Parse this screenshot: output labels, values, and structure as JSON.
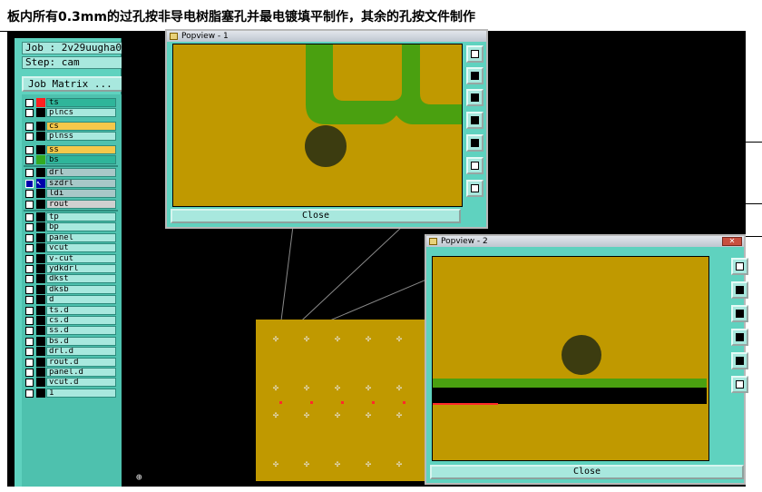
{
  "banner": {
    "text": "板内所有0.3mm的过孔按非导电树脂塞孔并最电镀填平制作，其余的孔按文件制作"
  },
  "job": {
    "job_label": "Job : 2v29uugha0",
    "step_label": "Step: cam",
    "matrix_button": "Job Matrix ..."
  },
  "layers": [
    {
      "name": "ts",
      "color": "#ff2020",
      "bg": "#2fb59a"
    },
    {
      "name": "plncs",
      "color": "#000000",
      "bg": "#a8e8de"
    },
    {
      "name": "cs",
      "color": "#000000",
      "bg": "#f5c84a"
    },
    {
      "name": "plnss",
      "color": "#000000",
      "bg": "#a8e8de"
    },
    {
      "name": "ss",
      "color": "#000000",
      "bg": "#f5c84a"
    },
    {
      "name": "bs",
      "color": "#33aa22",
      "bg": "#2fb59a"
    },
    {
      "name": "drl",
      "color": "#000000",
      "bg": "#a8c8c8"
    },
    {
      "name": "szdrl",
      "color": "#2020ff",
      "bg": "#a8c8c8",
      "active": true
    },
    {
      "name": "ldi",
      "color": "#000000",
      "bg": "#a8c8c8"
    },
    {
      "name": "rout",
      "color": "#000000",
      "bg": "#d0d0d0"
    },
    {
      "name": "tp",
      "color": "#000000",
      "bg": "#a8e8de"
    },
    {
      "name": "bp",
      "color": "#000000",
      "bg": "#a8e8de"
    },
    {
      "name": "panel",
      "color": "#000000",
      "bg": "#a8e8de"
    },
    {
      "name": "vcut",
      "color": "#000000",
      "bg": "#a8e8de"
    },
    {
      "name": "v-cut",
      "color": "#000000",
      "bg": "#a8e8de"
    },
    {
      "name": "ydkdrl",
      "color": "#000000",
      "bg": "#a8e8de"
    },
    {
      "name": "dkst",
      "color": "#000000",
      "bg": "#a8e8de"
    },
    {
      "name": "dksb",
      "color": "#000000",
      "bg": "#a8e8de"
    },
    {
      "name": "d",
      "color": "#000000",
      "bg": "#a8e8de"
    },
    {
      "name": "ts.d",
      "color": "#000000",
      "bg": "#a8e8de"
    },
    {
      "name": "cs.d",
      "color": "#000000",
      "bg": "#a8e8de"
    },
    {
      "name": "ss.d",
      "color": "#000000",
      "bg": "#a8e8de"
    },
    {
      "name": "bs.d",
      "color": "#000000",
      "bg": "#a8e8de"
    },
    {
      "name": "drl.d",
      "color": "#000000",
      "bg": "#a8e8de"
    },
    {
      "name": "rout.d",
      "color": "#000000",
      "bg": "#a8e8de"
    },
    {
      "name": "panel.d",
      "color": "#000000",
      "bg": "#a8e8de"
    },
    {
      "name": "vcut.d",
      "color": "#000000",
      "bg": "#a8e8de"
    },
    {
      "name": "1",
      "color": "#000000",
      "bg": "#a8e8de"
    }
  ],
  "popview1": {
    "title": "Popview - 1",
    "close_label": "Close"
  },
  "popview2": {
    "title": "Popview - 2",
    "close_label": "Close"
  },
  "colors": {
    "board": "#c09900",
    "copper_green": "#4aa010",
    "hole": "#3c3c10",
    "panel_teal": "#5fd2bf"
  },
  "icons": [
    "close-x-icon",
    "zoom-in-icon",
    "zoom-out-icon",
    "pan-left-icon",
    "pan-right-icon",
    "fit-icon",
    "home-icon",
    "crosshair-icon",
    "popup-window-icon"
  ]
}
